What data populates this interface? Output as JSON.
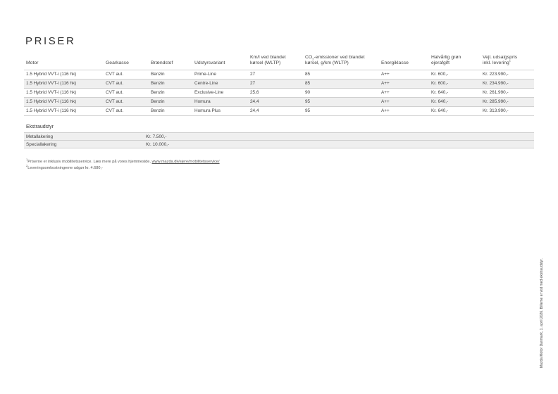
{
  "title": "PRISER",
  "price_table": {
    "headers": {
      "motor": "Motor",
      "gearkasse": "Gearkasse",
      "braendstof": "Brændstof",
      "udstyrsvariant": "Udstyrsvariant",
      "km_l_1": "Km/l ved blandet",
      "km_l_2": "kørsel (WLTP)",
      "co2_a": "CO",
      "co2_sub": "2",
      "co2_b": "-emissioner ved blandet",
      "co2_2": "kørsel, g/km (WLTP)",
      "energiklasse": "Energiklasse",
      "halvaarlig_1": "Halvårlig grøn",
      "halvaarlig_2": "ejerafgift",
      "pris_1": "Vejl. udsalgspris",
      "pris_2": "inkl. levering",
      "pris_sup": "1"
    },
    "rows": [
      {
        "motor": "1.5 Hybrid VVT-i (116 hk)",
        "gearkasse": "CVT aut.",
        "braendstof": "Benzin",
        "variant": "Prime-Line",
        "km_l": "27",
        "co2": "85",
        "energi": "A++",
        "afgift": "Kr. 600,-",
        "pris": "Kr. 223.990,-"
      },
      {
        "motor": "1.5 Hybrid VVT-i (116 hk)",
        "gearkasse": "CVT aut.",
        "braendstof": "Benzin",
        "variant": "Centre-Line",
        "km_l": "27",
        "co2": "85",
        "energi": "A++",
        "afgift": "Kr. 600,-",
        "pris": "Kr. 234.990,-"
      },
      {
        "motor": "1.5 Hybrid VVT-i (116 hk)",
        "gearkasse": "CVT aut.",
        "braendstof": "Benzin",
        "variant": "Exclusive-Line",
        "km_l": "25,6",
        "co2": "90",
        "energi": "A++",
        "afgift": "Kr. 640,-",
        "pris": "Kr. 261.990,-"
      },
      {
        "motor": "1.5 Hybrid VVT-i (116 hk)",
        "gearkasse": "CVT aut.",
        "braendstof": "Benzin",
        "variant": "Homura",
        "km_l": "24,4",
        "co2": "95",
        "energi": "A++",
        "afgift": "Kr. 640,-",
        "pris": "Kr. 285.990,-"
      },
      {
        "motor": "1.5 Hybrid VVT-i (116 hk)",
        "gearkasse": "CVT aut.",
        "braendstof": "Benzin",
        "variant": "Homura Plus",
        "km_l": "24,4",
        "co2": "95",
        "energi": "A++",
        "afgift": "Kr. 640,-",
        "pris": "Kr. 313.990,-"
      }
    ]
  },
  "extras": {
    "title": "Ekstraudstyr",
    "rows": [
      {
        "label": "Metallakering",
        "value": "Kr. 7.500,-"
      },
      {
        "label": "Speciallakering",
        "value": "Kr. 10.000,-"
      }
    ]
  },
  "footnotes": {
    "note1_sup": "1",
    "note1_text": "Priserne er inklusiv mobilitetsservice. Læs mere på vores hjemmeside, ",
    "note1_link": "www.mazda.dk/ejere/mobilitetsservice/",
    "note2_sup": "2",
    "note2_text": "Leveringsomkostningerne udgør kr. 4.680,-"
  },
  "side_note": "Mazda Motor Danmark, 1. april 2026. Billeme er vist med ekstraudstyr."
}
